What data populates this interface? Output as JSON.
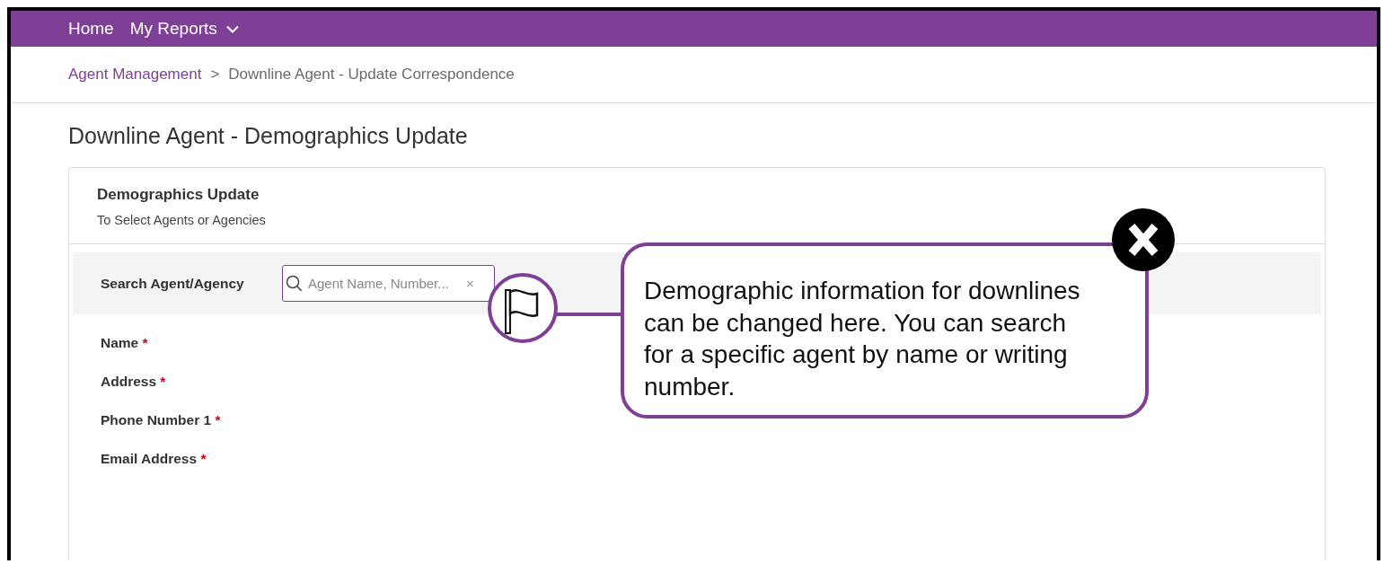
{
  "nav": {
    "items": [
      {
        "label": "Home",
        "dropdown": false
      },
      {
        "label": "My Reports",
        "dropdown": true
      }
    ]
  },
  "breadcrumb": [
    {
      "label": "Agent Management",
      "link": true
    },
    {
      "label": ">",
      "link": false
    },
    {
      "label": "Downline Agent - Update Correspondence",
      "link": false
    }
  ],
  "page_title": "Downline Agent - Demographics Update",
  "card": {
    "title": "Demographics Update",
    "subtitle": "To Select Agents or Agencies",
    "search": {
      "label": "Search Agent/Agency",
      "placeholder": "Agent Name, Number...",
      "clear": "×"
    },
    "fields": [
      {
        "label": "Name",
        "required": true
      },
      {
        "label": "Address",
        "required": true
      },
      {
        "label": "Phone Number 1",
        "required": true
      },
      {
        "label": "Email Address",
        "required": true
      }
    ],
    "required_mark": "*"
  },
  "callout": {
    "text": "Demographic information for downlines can be changed here. You can search for a specific agent by name or writing number."
  }
}
